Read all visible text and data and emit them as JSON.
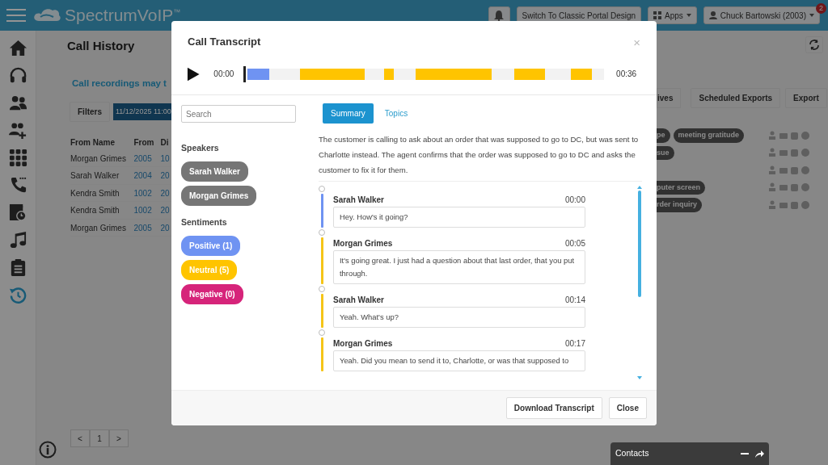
{
  "navbar": {
    "logo": "SpectrumVoIP",
    "logo_mark": "™",
    "switch_design": "Switch To Classic Portal Design",
    "apps": "Apps",
    "user": "Chuck Bartowski (2003)",
    "notification_count": "2"
  },
  "sidebar": {
    "items": [
      {
        "kind": "home",
        "selected": false
      },
      {
        "kind": "headset",
        "selected": false
      },
      {
        "kind": "users",
        "selected": false
      },
      {
        "kind": "user-plus",
        "selected": false
      },
      {
        "kind": "grid",
        "selected": false
      },
      {
        "kind": "phone",
        "selected": false
      },
      {
        "kind": "calendar",
        "selected": false
      },
      {
        "kind": "music",
        "selected": false
      },
      {
        "kind": "clipboard",
        "selected": false
      },
      {
        "kind": "history",
        "selected": true
      }
    ]
  },
  "page": {
    "title": "Call History",
    "notice": "Call recordings may t",
    "filters": "Filters",
    "date_chip": "11/12/2025 11:00",
    "toolbar": [
      "ives",
      "Scheduled Exports",
      "Export"
    ],
    "table": {
      "columns": [
        "From Name",
        "From",
        "Di"
      ],
      "rows": [
        {
          "from_name": "Morgan Grimes",
          "from": "2005",
          "column_3": "10",
          "tags": [
            "pe",
            "meeting gratitude"
          ]
        },
        {
          "from_name": "Sarah Walker",
          "from": "2004",
          "column_3": "20",
          "tags": [
            "sue"
          ]
        },
        {
          "from_name": "Kendra Smith",
          "from": "1002",
          "column_3": "20"
        },
        {
          "from_name": "Kendra Smith",
          "from": "1002",
          "column_3": "20",
          "tags": [
            "puter screen"
          ]
        },
        {
          "from_name": "Morgan Grimes",
          "from": "2005",
          "column_3": "20",
          "tags": [
            "rder inquiry"
          ]
        }
      ]
    },
    "pagination": [
      "<",
      "1",
      ">"
    ]
  },
  "modal": {
    "title": "Call Transcript",
    "close_symbol": "×",
    "player": {
      "current": "00:00",
      "duration": "00:36",
      "level": 0
    },
    "search": {
      "placeholder": "Search"
    },
    "speakers_heading": "Speakers",
    "speakers": [
      "Sarah Walker",
      "Morgan Grimes"
    ],
    "sentiments_heading": "Sentiments",
    "sentiments": [
      {
        "label": "Positive (1)",
        "color": "#6f93f2"
      },
      {
        "label": "Neutral (5)",
        "color": "#ffc400"
      },
      {
        "label": "Negative (0)",
        "color": "#d6247a"
      }
    ],
    "tabs": [
      {
        "label": "Summary",
        "selected": true
      },
      {
        "label": "Topics",
        "selected": false
      }
    ],
    "summary": "The customer is calling to ask about an order that was supposed to go to DC, but was sent to Charlotte instead. The agent confirms that the order was supposed to go to DC and asks the customer to fix it for them.",
    "transcript": [
      {
        "speaker": "Sarah Walker",
        "time": "00:00",
        "text": "Hey. How's it going?",
        "color": "#6f93f2"
      },
      {
        "speaker": "Morgan Grimes",
        "time": "00:05",
        "text": "It's going great. I just had a question about that last order, that you put through.",
        "color": "#f5c518"
      },
      {
        "speaker": "Sarah Walker",
        "time": "00:14",
        "text": "Yeah. What's up?",
        "color": "#f5c518"
      },
      {
        "speaker": "Morgan Grimes",
        "time": "00:17",
        "text": "Yeah. Did you mean to send it to, Charlotte, or was that supposed to",
        "color": "#f5c518"
      }
    ],
    "footer_buttons": [
      "Download Transcript",
      "Close"
    ]
  },
  "contacts": {
    "title": "Contacts"
  }
}
